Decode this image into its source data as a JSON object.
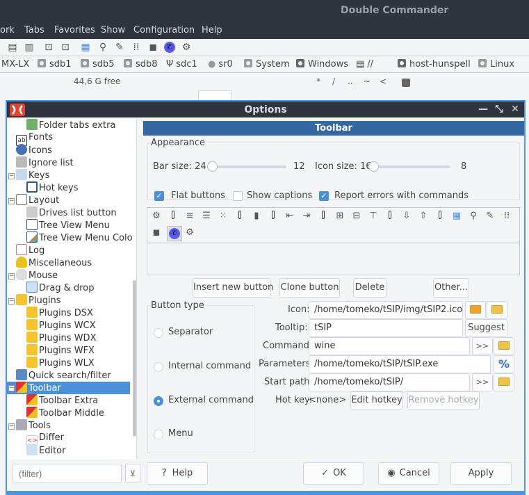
{
  "main_window": {
    "title": "Double Commander",
    "menu": [
      "ork",
      "Tabs",
      "Favorites",
      "Show",
      "Configuration",
      "Help"
    ],
    "toolbar_icons": [
      "view-brief-icon",
      "view-columns-icon",
      "pack-icon",
      "unpack-icon",
      "documents-icon",
      "search-icon",
      "edit-icon",
      "sync-dirs-icon",
      "copy-window-icon",
      "tsip-phone-icon",
      "gear-icon"
    ],
    "drives": [
      {
        "label": "MX-LX",
        "icon": "disk"
      },
      {
        "label": "sdb1",
        "icon": "disk"
      },
      {
        "label": "sdb5",
        "icon": "disk"
      },
      {
        "label": "sdb8",
        "icon": "disk"
      },
      {
        "label": "sdc1",
        "icon": "usb"
      },
      {
        "label": "sr0",
        "icon": "cdrom"
      },
      {
        "label": "System",
        "icon": "disk"
      },
      {
        "label": "Windows",
        "icon": "disk"
      },
      {
        "label": "//",
        "icon": "network"
      },
      {
        "label": "host-hunspell",
        "icon": "disk"
      },
      {
        "label": "Linux",
        "icon": "disk"
      }
    ],
    "free_space": "44,6 G free",
    "path_shortcuts": [
      "*",
      "/",
      "..",
      "~",
      "<"
    ]
  },
  "dialog": {
    "title": "Options",
    "tree": [
      {
        "label": "Folder tabs extra",
        "level": 1
      },
      {
        "label": "Fonts",
        "level": 0
      },
      {
        "label": "Icons",
        "level": 0
      },
      {
        "label": "Ignore list",
        "level": 0
      },
      {
        "label": "Keys",
        "level": 0,
        "expanded": true
      },
      {
        "label": "Hot keys",
        "level": 1
      },
      {
        "label": "Layout",
        "level": 0,
        "expanded": true
      },
      {
        "label": "Drives list button",
        "level": 1
      },
      {
        "label": "Tree View Menu",
        "level": 1
      },
      {
        "label": "Tree View Menu Colo",
        "level": 1
      },
      {
        "label": "Log",
        "level": 0
      },
      {
        "label": "Miscellaneous",
        "level": 0
      },
      {
        "label": "Mouse",
        "level": 0,
        "expanded": true
      },
      {
        "label": "Drag & drop",
        "level": 1
      },
      {
        "label": "Plugins",
        "level": 0,
        "expanded": true
      },
      {
        "label": "Plugins DSX",
        "level": 1
      },
      {
        "label": "Plugins WCX",
        "level": 1
      },
      {
        "label": "Plugins WDX",
        "level": 1
      },
      {
        "label": "Plugins WFX",
        "level": 1
      },
      {
        "label": "Plugins WLX",
        "level": 1
      },
      {
        "label": "Quick search/filter",
        "level": 0
      },
      {
        "label": "Toolbar",
        "level": 0,
        "expanded": true,
        "selected": true
      },
      {
        "label": "Toolbar Extra",
        "level": 1
      },
      {
        "label": "Toolbar Middle",
        "level": 1
      },
      {
        "label": "Tools",
        "level": 0,
        "expanded": true
      },
      {
        "label": "Differ",
        "level": 1
      },
      {
        "label": "Editor",
        "level": 1
      }
    ],
    "filter_placeholder": "(filter)",
    "panel_title": "Toolbar",
    "appearance": {
      "legend": "Appearance",
      "bar_size_label": "Bar size: 24",
      "bar_size_value": 24,
      "bar_size_min": "12",
      "icon_size_label": "Icon size: 16",
      "icon_size_value": 16,
      "icon_size_min": "8",
      "flat_buttons": {
        "label": "Flat buttons",
        "checked": true
      },
      "show_captions": {
        "label": "Show captions",
        "checked": false
      },
      "report_errors": {
        "label": "Report errors with commands",
        "checked": true
      }
    },
    "toolbar_buttons": [
      "gear",
      "separator",
      "list-brief",
      "list-full",
      "list-thumbs",
      "separator",
      "columns",
      "separator",
      "left-arrow-box",
      "right-arrow-box",
      "separator",
      "plus-box",
      "minus-box",
      "t-box",
      "separator",
      "download-box",
      "upload-box",
      "separator",
      "documents",
      "search",
      "edit",
      "sync",
      "copy-window",
      "tsip-phone",
      "gear"
    ],
    "actions": {
      "insert": "Insert new button",
      "clone": "Clone button",
      "delete": "Delete",
      "other": "Other..."
    },
    "button_type": {
      "legend": "Button type",
      "options": [
        "Separator",
        "Internal command",
        "External command",
        "Menu"
      ],
      "selected": "External command"
    },
    "fields": {
      "icon_label": "Icon:",
      "icon_value": "/home/tomeko/tSIP/img/tSIP2.ico",
      "tooltip_label": "Tooltip:",
      "tooltip_value": "tSIP",
      "suggest": "Suggest",
      "command_label": "Command:",
      "command_value": "wine",
      "parameters_label": "Parameters:",
      "parameters_value": "/home/tomeko/tSIP/tSIP.exe",
      "percent": "%",
      "start_path_label": "Start path:",
      "start_path_value": "/home/tomeko/tSIP/",
      "arrow": ">>",
      "hotkey_label": "Hot key:",
      "hotkey_value": "<none>",
      "edit_hotkey": "Edit hotkey",
      "remove_hotkey": "Remove hotkey"
    },
    "footer": {
      "help": "Help",
      "ok": "OK",
      "cancel": "Cancel",
      "apply": "Apply"
    }
  }
}
